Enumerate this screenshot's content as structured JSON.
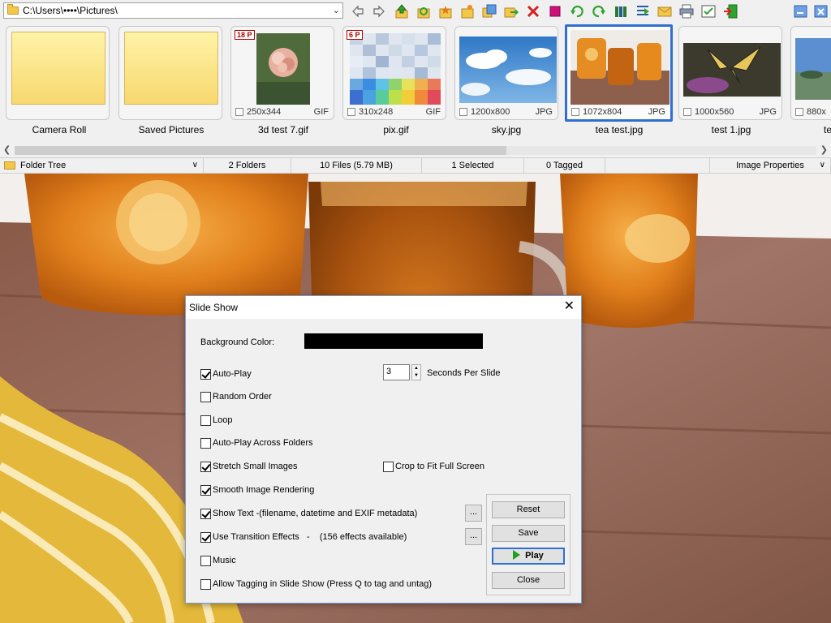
{
  "toolbar": {
    "path": "C:\\Users\\••••\\Pictures\\"
  },
  "icons": [
    "back-arrow-icon",
    "forward-arrow-icon",
    "up-folder-icon",
    "refresh-icon",
    "favorite-folder-icon",
    "new-folder-icon",
    "copy-to-icon",
    "move-to-icon",
    "delete-icon",
    "tag-icon",
    "rotate-left-icon",
    "rotate-right-icon",
    "compare-icon",
    "slideshow-icon",
    "email-icon",
    "print-icon",
    "options-icon",
    "exit-icon"
  ],
  "thumbnails": [
    {
      "caption": "Camera Roll",
      "type": "folder"
    },
    {
      "caption": "Saved Pictures",
      "type": "folder"
    },
    {
      "caption": "3d test 7.gif",
      "dims": "250x344",
      "fmt": "GIF",
      "badge": "18 P"
    },
    {
      "caption": "pix.gif",
      "dims": "310x248",
      "fmt": "GIF",
      "badge": "6 P"
    },
    {
      "caption": "sky.jpg",
      "dims": "1200x800",
      "fmt": "JPG"
    },
    {
      "caption": "tea test.jpg",
      "dims": "1072x804",
      "fmt": "JPG",
      "selected": true
    },
    {
      "caption": "test 1.jpg",
      "dims": "1000x560",
      "fmt": "JPG"
    },
    {
      "caption": "te",
      "dims": "880x",
      "fmt": ""
    }
  ],
  "status": {
    "folder_tree": "Folder Tree",
    "folders": "2 Folders",
    "files": "10 Files (5.79 MB)",
    "selected": "1 Selected",
    "tagged": "0 Tagged",
    "image_properties": "Image Properties"
  },
  "dialog": {
    "title": "Slide Show",
    "background_color_label": "Background Color:",
    "background_color": "#000000",
    "auto_play": "Auto-Play",
    "seconds_value": "3",
    "seconds_label": "Seconds Per Slide",
    "random_order": "Random Order",
    "loop": "Loop",
    "auto_play_folders": "Auto-Play Across Folders",
    "stretch_small": "Stretch Small Images",
    "crop_fit": "Crop to Fit Full Screen",
    "smooth_rendering": "Smooth Image Rendering",
    "show_text": "Show Text -(filename, datetime and EXIF metadata)",
    "transition_effects": "Use Transition Effects   -    (156 effects available)",
    "music": "Music",
    "allow_tagging": "Allow Tagging in Slide Show (Press Q to tag and untag)",
    "dots": "...",
    "reset": "Reset",
    "save": "Save",
    "play": "Play",
    "close": "Close"
  }
}
